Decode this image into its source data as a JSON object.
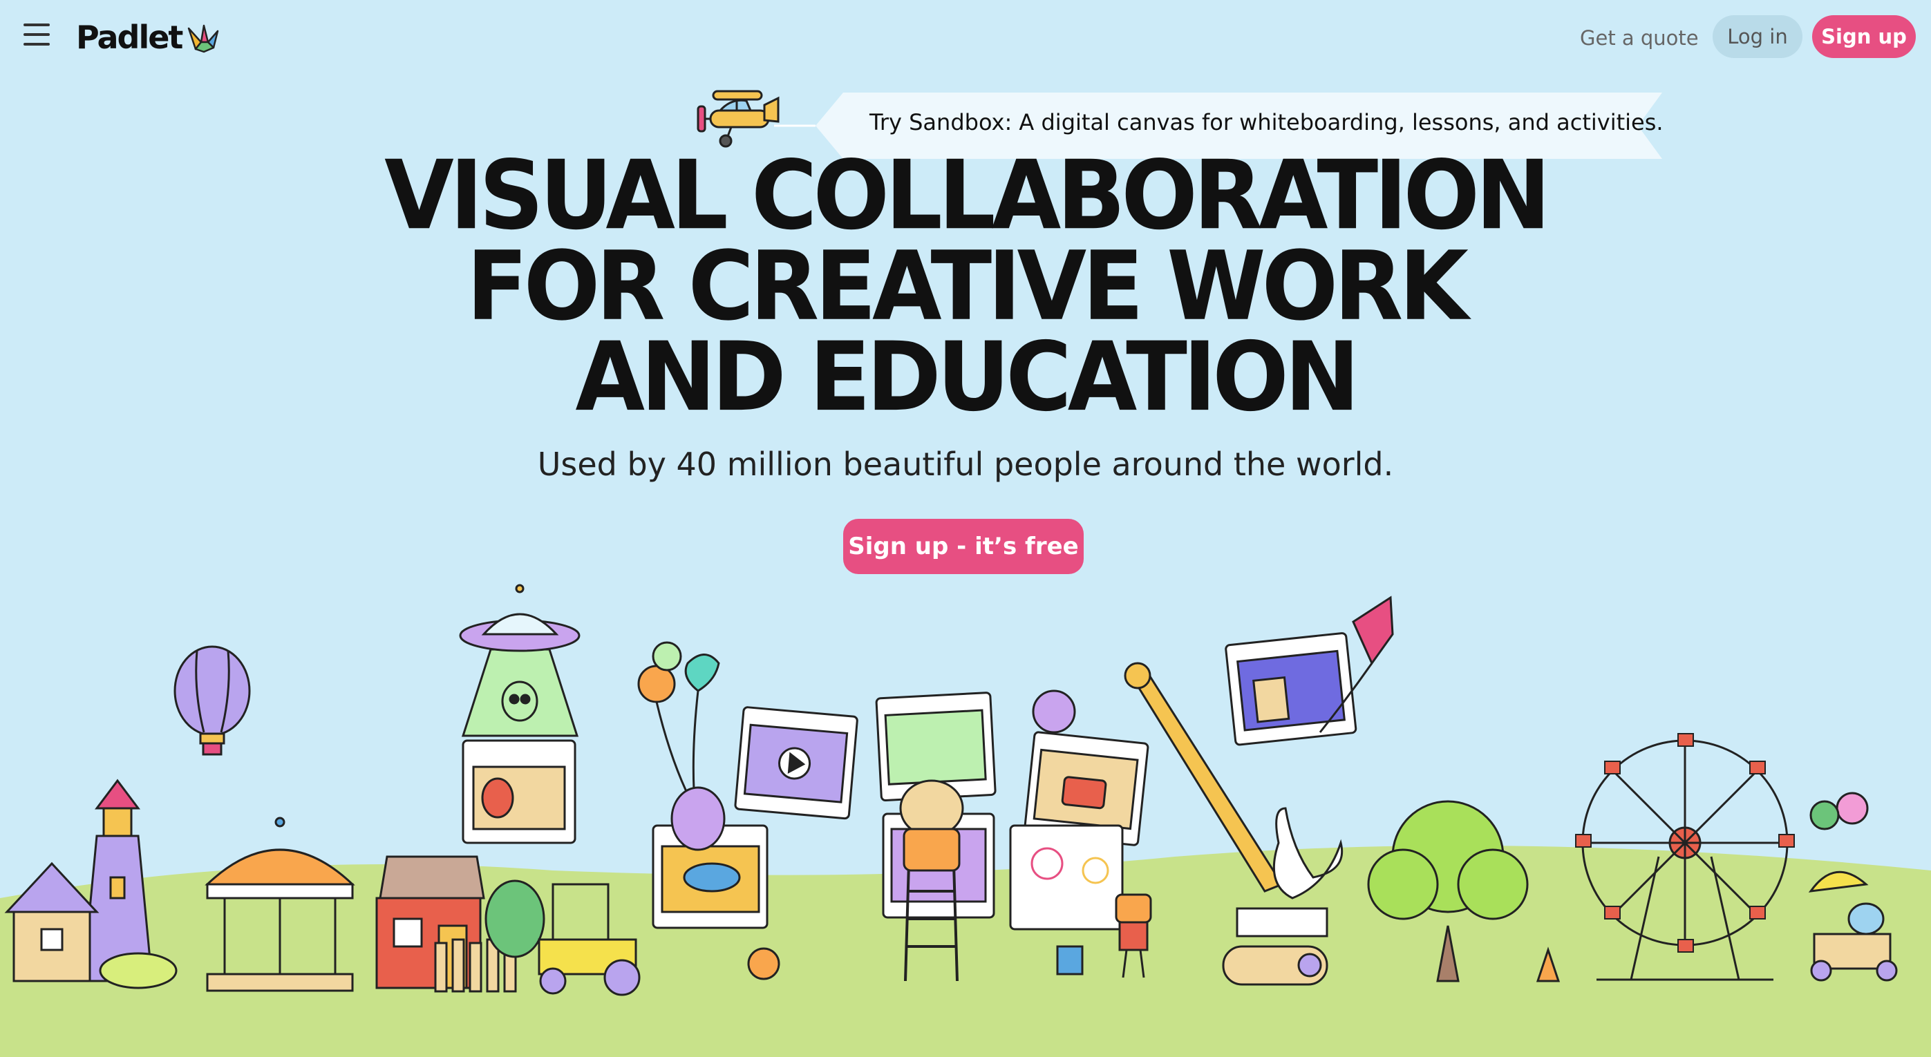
{
  "header": {
    "menu_icon": "hamburger-menu-icon",
    "logo_text": "Padlet",
    "logo_icon": "paper-crane-icon",
    "nav": {
      "quote_label": "Get a quote",
      "login_label": "Log in",
      "signup_label": "Sign up"
    }
  },
  "promo": {
    "text": "Try Sandbox: A digital canvas for whiteboarding, lessons, and activities.",
    "icon": "airplane-icon"
  },
  "hero": {
    "title_lines": [
      "VISUAL COLLABORATION",
      "FOR CREATIVE WORK",
      "AND EDUCATION"
    ],
    "subtitle": "Used by 40 million beautiful people around the world.",
    "cta_label": "Sign up - it’s free"
  },
  "colors": {
    "background": "#cdebf8",
    "grass": "#c8e28a",
    "accent": "#e74f82",
    "login_bg": "#b9dbe9"
  }
}
